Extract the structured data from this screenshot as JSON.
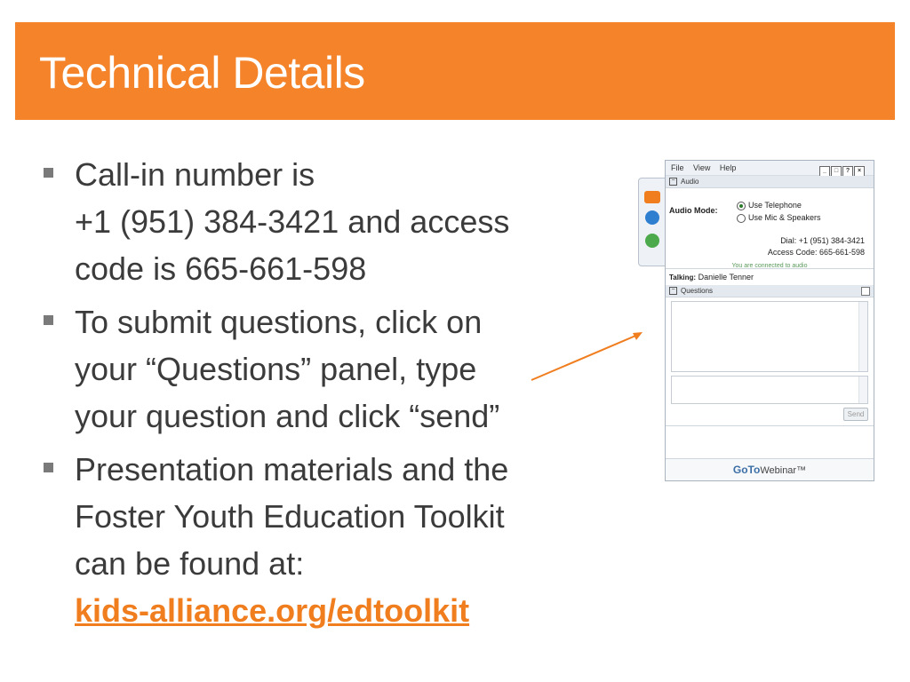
{
  "slide": {
    "title": "Technical Details"
  },
  "bullets": {
    "b1_line1": "Call-in number is",
    "b1_line2": "+1 (951) 384-3421 and access",
    "b1_line3": "code is 665-661-598",
    "b2_line1": "To submit questions, click on",
    "b2_line2": "your “Questions” panel, type",
    "b2_line3": "your question and click “send”",
    "b3_line1": "Presentation materials and the",
    "b3_line2": "Foster Youth Education Toolkit",
    "b3_line3": "can be found at:",
    "b3_link": "kids-alliance.org/edtoolkit"
  },
  "panel": {
    "menu": [
      "File",
      "View",
      "Help"
    ],
    "audio_header": "Audio",
    "audio_mode_label": "Audio Mode:",
    "option_telephone": "Use Telephone",
    "option_mic": "Use Mic & Speakers",
    "dial_line": "Dial: +1 (951) 384-3421",
    "access_line": "Access Code: 665-661-598",
    "connected": "You are connected to audio",
    "talking_label": "Talking:",
    "talking_name": "Danielle Tenner",
    "questions_header": "Questions",
    "send_label": "Send",
    "footer_goto": "GoTo",
    "footer_webinar": "Webinar™"
  },
  "colors": {
    "accent": "#f4832a",
    "link": "#f07d1e",
    "text": "#3b3b3b"
  }
}
